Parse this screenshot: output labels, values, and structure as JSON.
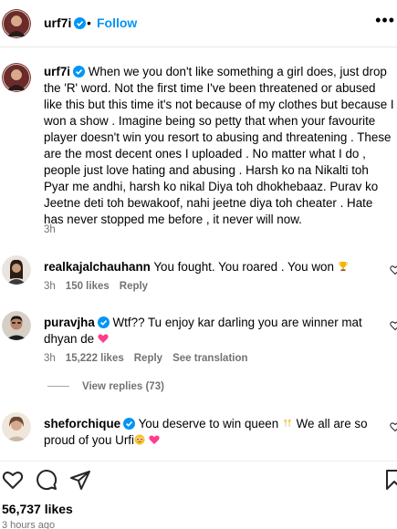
{
  "header": {
    "username": "urf7i",
    "separator": "•",
    "follow_label": "Follow",
    "more_label": "•••"
  },
  "caption": {
    "username": "urf7i",
    "text": "When we you don't like something a girl does, just drop the 'R' word. Not the first time I've been threatened or abused like this but this time it's not because of my clothes but because I won a show . Imagine being so petty that when your favourite player doesn't win you resort to abusing and threatening . These are the most decent ones I uploaded . No matter what I do , people just love hating and abusing . Harsh ko na Nikalti toh Pyar me andhi, harsh ko nikal Diya toh dhokhebaaz. Purav ko Jeetne deti toh bewakoof, nahi jeetne diya toh cheater . Hate has never stopped me before , it never will now.",
    "time": "3h"
  },
  "comments": [
    {
      "username": "realkajalchauhann",
      "verified": false,
      "text": "You fought. You roared . You won",
      "emoji": "trophy",
      "time": "3h",
      "likes": "150 likes",
      "reply_label": "Reply"
    },
    {
      "username": "puravjha",
      "verified": true,
      "text": "Wtf?? Tu enjoy kar darling you are winner mat dhyan de",
      "emoji": "pink-heart",
      "time": "3h",
      "likes": "15,222 likes",
      "reply_label": "Reply",
      "translate_label": "See translation"
    },
    {
      "username": "sheforchique",
      "verified": true,
      "text_part1": "You deserve to win queen",
      "text_part2": "We all are so proud of you Urfi",
      "emoji": [
        "clinking-glasses",
        "pleading-face",
        "pink-heart"
      ]
    }
  ],
  "view_replies_label": "View replies (73)",
  "actions": {
    "icons": [
      "heart-icon",
      "comment-icon",
      "share-icon",
      "bookmark-icon"
    ]
  },
  "likes_count": "56,737 likes",
  "posted_time": "3 hours ago",
  "colors": {
    "link_blue": "#0095f6",
    "verified_blue": "#0095f6",
    "meta_gray": "#737373",
    "pink_heart": "#ff3d8a"
  }
}
